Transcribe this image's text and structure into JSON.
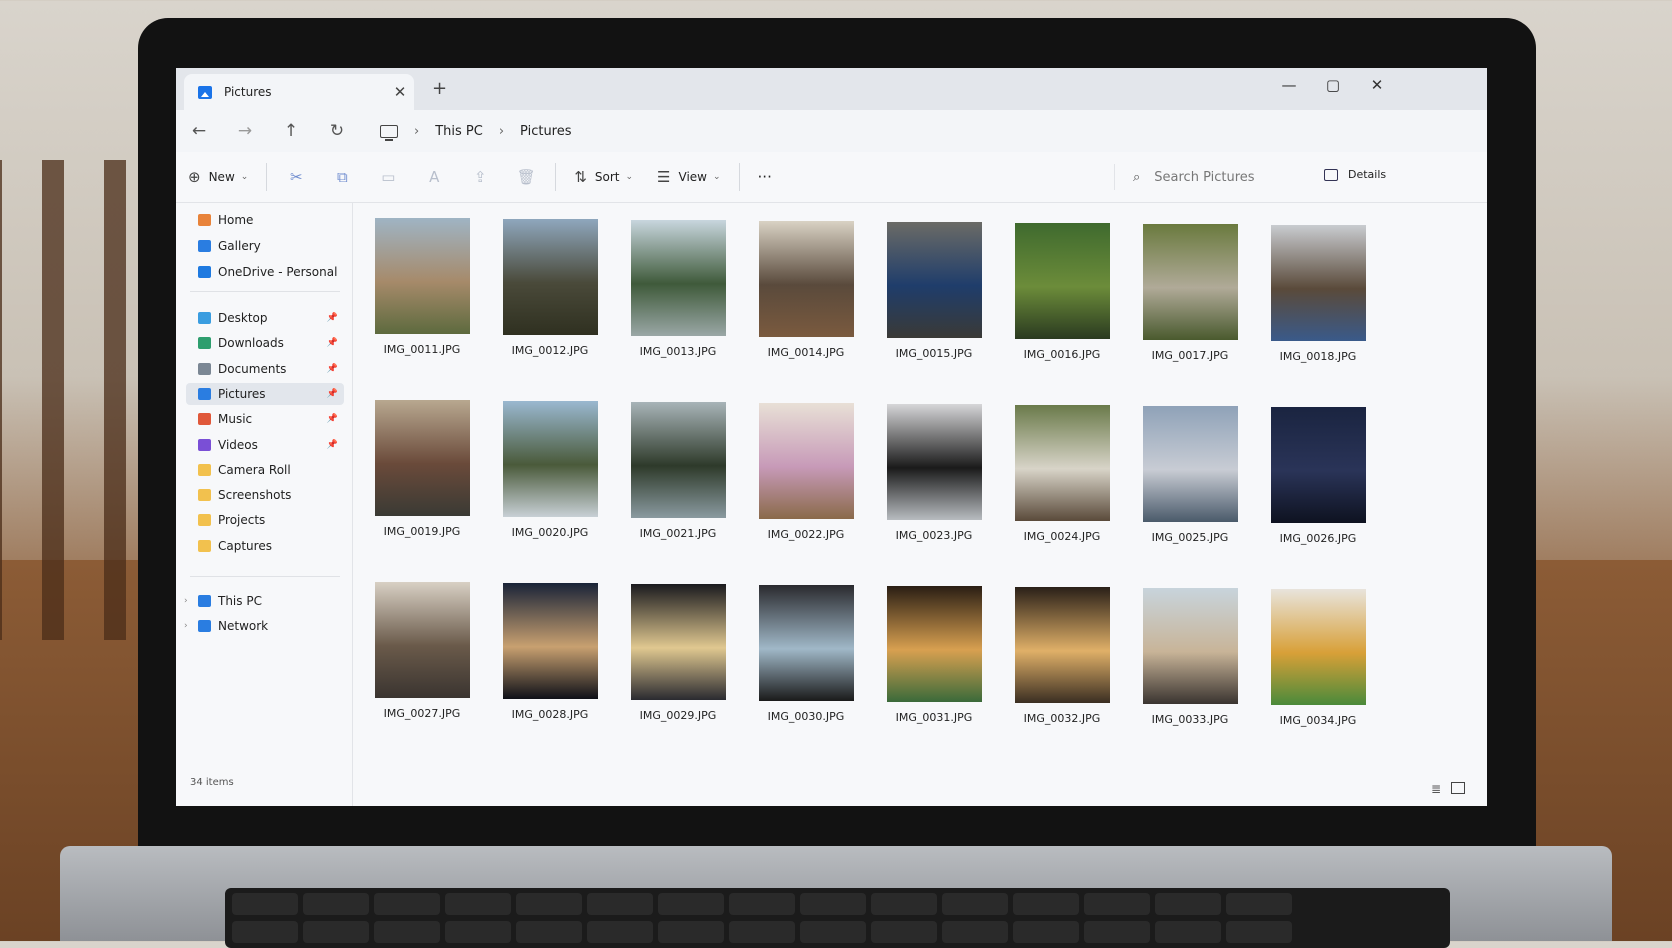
{
  "window": {
    "tab_title": "Pictures",
    "tab_close": "✕",
    "new_tab": "+",
    "minimize": "—",
    "maximize": "▢",
    "close": "✕"
  },
  "navigation": {
    "back": "←",
    "forward": "→",
    "up": "↑",
    "refresh": "↻",
    "breadcrumb": [
      "This PC",
      "Pictures"
    ],
    "separator": "›"
  },
  "toolbar": {
    "new_label": "New",
    "sort_label": "Sort",
    "view_label": "View",
    "more_label": "···",
    "details_label": "Details",
    "cut_icon": "✂",
    "copy_icon": "⧉",
    "paste_icon": "📋",
    "rename_icon": "A",
    "share_icon": "⇪",
    "delete_icon": "🗑"
  },
  "search": {
    "placeholder": "Search Pictures",
    "icon": "⌕"
  },
  "sidebar": {
    "quick": [
      {
        "label": "Home",
        "icon": "home-icon",
        "color": "#e8833a"
      },
      {
        "label": "Gallery",
        "icon": "gallery-icon",
        "color": "#2a7de1"
      },
      {
        "label": "OneDrive - Personal",
        "icon": "onedrive-icon",
        "color": "#1f7ae0"
      }
    ],
    "pinned": [
      {
        "label": "Desktop",
        "icon": "desktop-icon",
        "color": "#3a9de0",
        "pin": true
      },
      {
        "label": "Downloads",
        "icon": "downloads-icon",
        "color": "#2e9e6e",
        "pin": true
      },
      {
        "label": "Documents",
        "icon": "documents-icon",
        "color": "#7b8794",
        "pin": true
      },
      {
        "label": "Pictures",
        "icon": "pictures-icon",
        "color": "#2a7de1",
        "pin": true,
        "active": true
      },
      {
        "label": "Music",
        "icon": "music-icon",
        "color": "#e0583a",
        "pin": true
      },
      {
        "label": "Videos",
        "icon": "videos-icon",
        "color": "#7a4fd6",
        "pin": true
      },
      {
        "label": "Camera Roll",
        "icon": "folder-icon",
        "color": "#f2c14e",
        "pin": false
      },
      {
        "label": "Screenshots",
        "icon": "folder-icon",
        "color": "#f2c14e",
        "pin": false
      },
      {
        "label": "Projects",
        "icon": "folder-icon",
        "color": "#f2c14e",
        "pin": false
      },
      {
        "label": "Captures",
        "icon": "folder-icon",
        "color": "#f2c14e",
        "pin": false
      }
    ],
    "system": [
      {
        "label": "This PC",
        "icon": "pc-icon",
        "color": "#2a7de1"
      },
      {
        "label": "Network",
        "icon": "network-icon",
        "color": "#2a7de1"
      }
    ],
    "pin_glyph": "📌",
    "expand_glyph": "›",
    "item_count": "34 items"
  },
  "files": [
    {
      "name": "IMG_0011.JPG",
      "colors": [
        "#9fb4c4",
        "#a68a6a",
        "#5d6a3e"
      ]
    },
    {
      "name": "IMG_0012.JPG",
      "colors": [
        "#8fa7bd",
        "#4a4a3a",
        "#2f3020"
      ]
    },
    {
      "name": "IMG_0013.JPG",
      "colors": [
        "#c8d6de",
        "#3f5a3a",
        "#9aa7a6"
      ]
    },
    {
      "name": "IMG_0014.JPG",
      "colors": [
        "#d9d2c4",
        "#5a4a3c",
        "#7a5a3e"
      ]
    },
    {
      "name": "IMG_0015.JPG",
      "colors": [
        "#6b6b66",
        "#1f3d6b",
        "#3a3a36"
      ]
    },
    {
      "name": "IMG_0016.JPG",
      "colors": [
        "#3f6a2e",
        "#6c8c3a",
        "#2a3a20"
      ]
    },
    {
      "name": "IMG_0017.JPG",
      "colors": [
        "#6a7a3e",
        "#b0aa98",
        "#4a5a2e"
      ]
    },
    {
      "name": "IMG_0018.JPG",
      "colors": [
        "#c9ccd0",
        "#5a4a3a",
        "#3a5a8a"
      ]
    },
    {
      "name": "IMG_0019.JPG",
      "colors": [
        "#b8a890",
        "#6a4a3a",
        "#3a3a34"
      ]
    },
    {
      "name": "IMG_0020.JPG",
      "colors": [
        "#9ab8d0",
        "#4a5a3a",
        "#c8d0d6"
      ]
    },
    {
      "name": "IMG_0021.JPG",
      "colors": [
        "#a8b4b8",
        "#2e3a2a",
        "#8a9aa0"
      ]
    },
    {
      "name": "IMG_0022.JPG",
      "colors": [
        "#e8e0d6",
        "#c79ab8",
        "#8a6a4a"
      ]
    },
    {
      "name": "IMG_0023.JPG",
      "colors": [
        "#d6d6d8",
        "#1a1a1a",
        "#b8bcc0"
      ]
    },
    {
      "name": "IMG_0024.JPG",
      "colors": [
        "#6a7a4a",
        "#d8d4c8",
        "#5a4a3a"
      ]
    },
    {
      "name": "IMG_0025.JPG",
      "colors": [
        "#8fa2b8",
        "#c8ccd4",
        "#4a5a6a"
      ]
    },
    {
      "name": "IMG_0026.JPG",
      "colors": [
        "#1a2440",
        "#2a3458",
        "#0e1220"
      ]
    },
    {
      "name": "IMG_0027.JPG",
      "colors": [
        "#d8d0c4",
        "#6a5a4a",
        "#3a3430"
      ]
    },
    {
      "name": "IMG_0028.JPG",
      "colors": [
        "#1a2438",
        "#c8a070",
        "#0e1018"
      ]
    },
    {
      "name": "IMG_0029.JPG",
      "colors": [
        "#1a1a1e",
        "#e0c890",
        "#2a2a30"
      ]
    },
    {
      "name": "IMG_0030.JPG",
      "colors": [
        "#2a2a2e",
        "#a0b8c8",
        "#1a1a1a"
      ]
    },
    {
      "name": "IMG_0031.JPG",
      "colors": [
        "#2a1e14",
        "#d8a050",
        "#3a6a3a"
      ]
    },
    {
      "name": "IMG_0032.JPG",
      "colors": [
        "#2a2018",
        "#e0b068",
        "#3a2e22"
      ]
    },
    {
      "name": "IMG_0033.JPG",
      "colors": [
        "#c8d4dc",
        "#c8b498",
        "#3a3430"
      ]
    },
    {
      "name": "IMG_0034.JPG",
      "colors": [
        "#e8e4dc",
        "#d8a038",
        "#4a8a3a"
      ]
    }
  ]
}
